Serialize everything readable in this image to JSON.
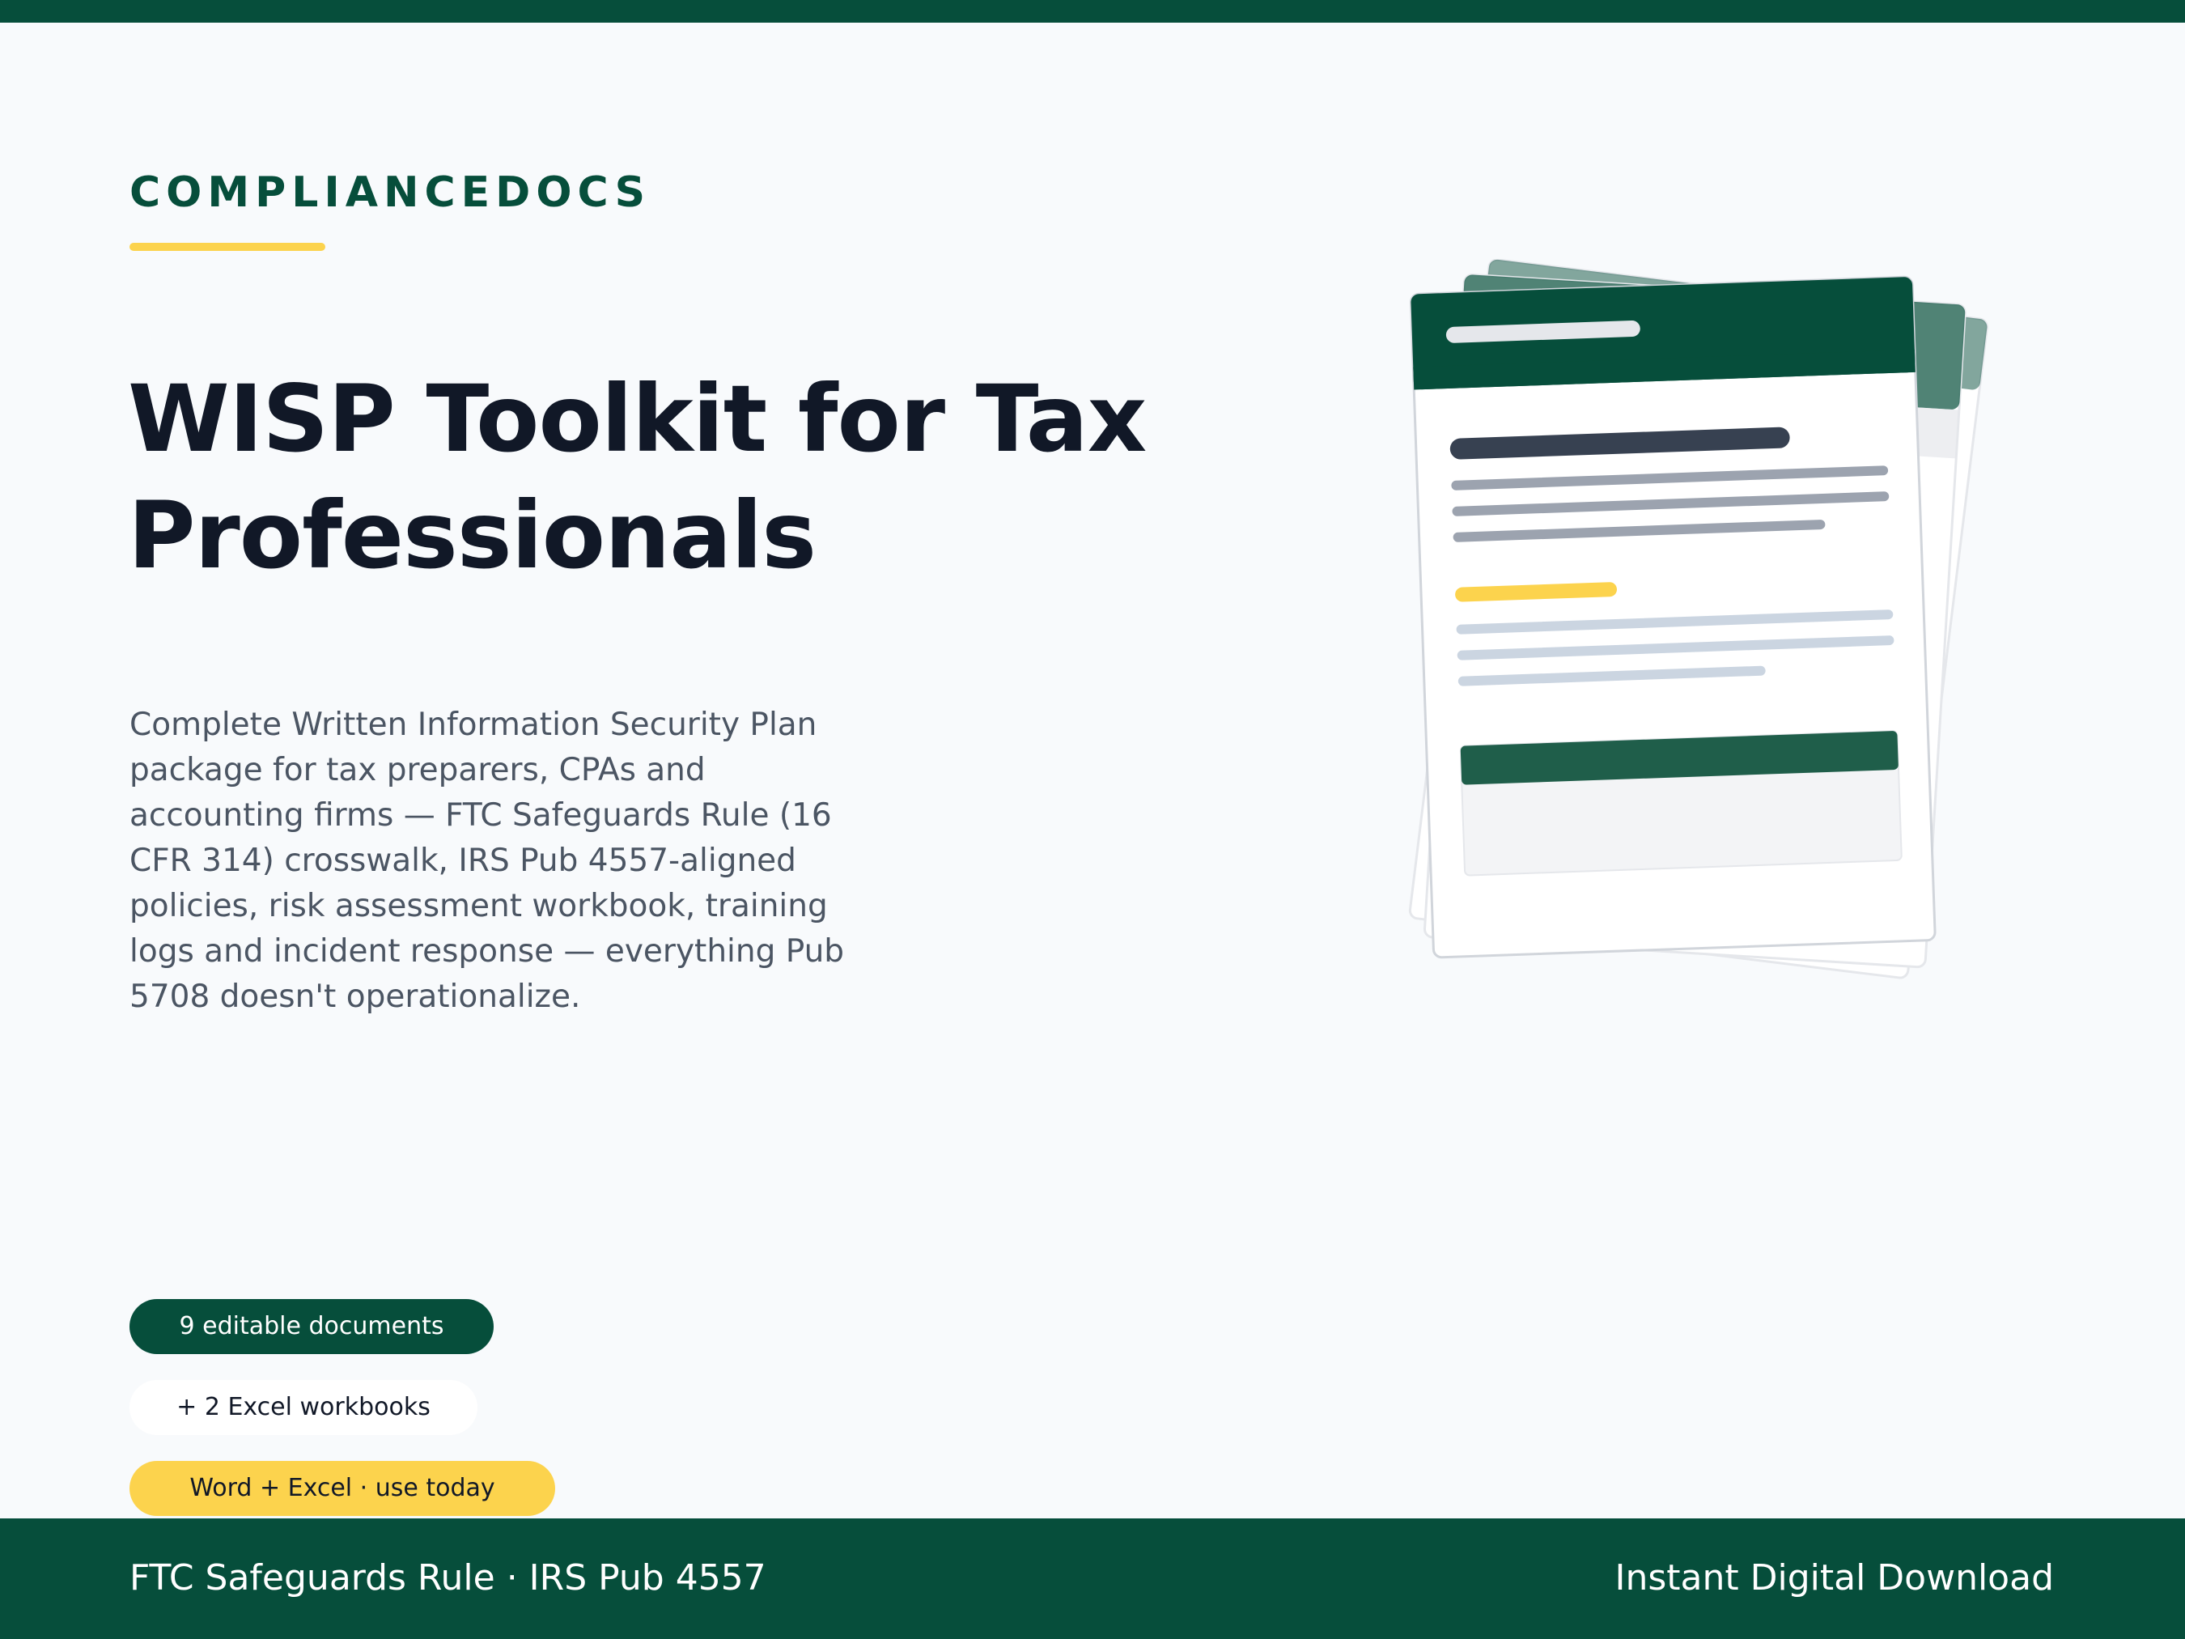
{
  "brand": {
    "name": "COMPLIANCEDOCS",
    "accent_color": "#fcd34d",
    "primary_color": "#064e3b"
  },
  "hero": {
    "title": "WISP Toolkit for Tax Professionals",
    "description": "Complete Written Information Security Plan package for tax preparers, CPAs and accounting firms — FTC Safeguards Rule (16 CFR 314) crosswalk, IRS Pub 4557-aligned policies, risk assessment workbook, training logs and incident response — everything Pub 5708 doesn't operationalize."
  },
  "badges": {
    "documents": "9 editable documents",
    "workbooks": "+ 2 Excel workbooks",
    "formats": "Word + Excel · use today"
  },
  "footer": {
    "left_text": "FTC Safeguards Rule · IRS Pub 4557",
    "right_text": "Instant Digital Download"
  },
  "illustration": {
    "icon": "document-stack-icon"
  }
}
